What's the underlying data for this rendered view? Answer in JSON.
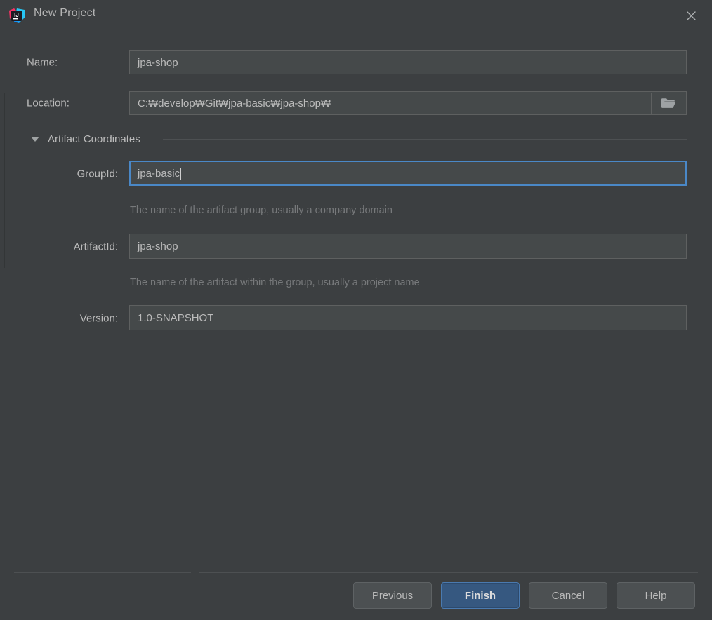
{
  "window": {
    "title": "New Project",
    "app_icon": "intellij-idea-icon",
    "close_icon": "close-icon"
  },
  "form": {
    "name": {
      "label": "Name:",
      "value": "jpa-shop",
      "focused": false
    },
    "location": {
      "label": "Location:",
      "value": "C:₩develop₩Git₩jpa-basic₩jpa-shop₩",
      "browse_icon": "folder-icon",
      "focused": false
    }
  },
  "artifact_section": {
    "title": "Artifact Coordinates",
    "expanded": true,
    "toggle_icon": "triangle-down-icon",
    "fields": {
      "group_id": {
        "label": "GroupId:",
        "value": "jpa-basic",
        "focused": true,
        "hint": "The name of the artifact group, usually a company domain"
      },
      "artifact_id": {
        "label": "ArtifactId:",
        "value": "jpa-shop",
        "focused": false,
        "hint": "The name of the artifact within the group, usually a project name"
      },
      "version": {
        "label": "Version:",
        "value": "1.0-SNAPSHOT",
        "focused": false
      }
    }
  },
  "footer": {
    "buttons": [
      {
        "id": "previous",
        "label": "Previous",
        "mnemonic": "P",
        "primary": false
      },
      {
        "id": "finish",
        "label": "Finish",
        "mnemonic": "F",
        "primary": true
      },
      {
        "id": "cancel",
        "label": "Cancel",
        "mnemonic": "",
        "primary": false
      },
      {
        "id": "help",
        "label": "Help",
        "mnemonic": "",
        "primary": false
      }
    ]
  },
  "colors": {
    "dialog_bg": "#3c3f41",
    "field_bg": "#45494a",
    "field_border": "#5e6060",
    "focus_border": "#4a88c7",
    "primary_button": "#365880",
    "text": "#bbbbbb",
    "hint_text": "#77797b",
    "separator": "#4d5052"
  }
}
